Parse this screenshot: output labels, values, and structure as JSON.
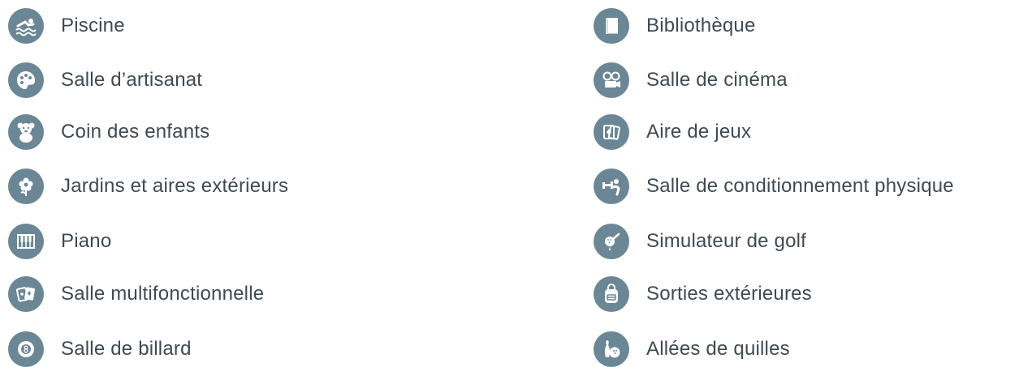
{
  "colors": {
    "icon_background": "#6b8795",
    "text": "#3f4a52"
  },
  "amenities_left": [
    {
      "label": "Piscine",
      "icon": "swimmer-icon"
    },
    {
      "label": "Salle d’artisanat",
      "icon": "palette-icon"
    },
    {
      "label": "Coin des enfants",
      "icon": "teddy-bear-icon"
    },
    {
      "label": "Jardins et aires extérieurs",
      "icon": "flower-icon"
    },
    {
      "label": "Piano",
      "icon": "piano-keys-icon"
    },
    {
      "label": "Salle multifonctionnelle",
      "icon": "playing-cards-icon"
    },
    {
      "label": "Salle de billard",
      "icon": "billiard-ball-icon"
    }
  ],
  "amenities_right": [
    {
      "label": "Bibliothèque",
      "icon": "book-icon"
    },
    {
      "label": "Salle de cinéma",
      "icon": "film-camera-icon"
    },
    {
      "label": "Aire de jeux",
      "icon": "cards-icon"
    },
    {
      "label": "Salle de conditionnement physique",
      "icon": "fitness-icon"
    },
    {
      "label": "Simulateur de golf",
      "icon": "golf-icon"
    },
    {
      "label": "Sorties extérieures",
      "icon": "backpack-icon"
    },
    {
      "label": "Allées de quilles",
      "icon": "bowling-icon"
    }
  ]
}
